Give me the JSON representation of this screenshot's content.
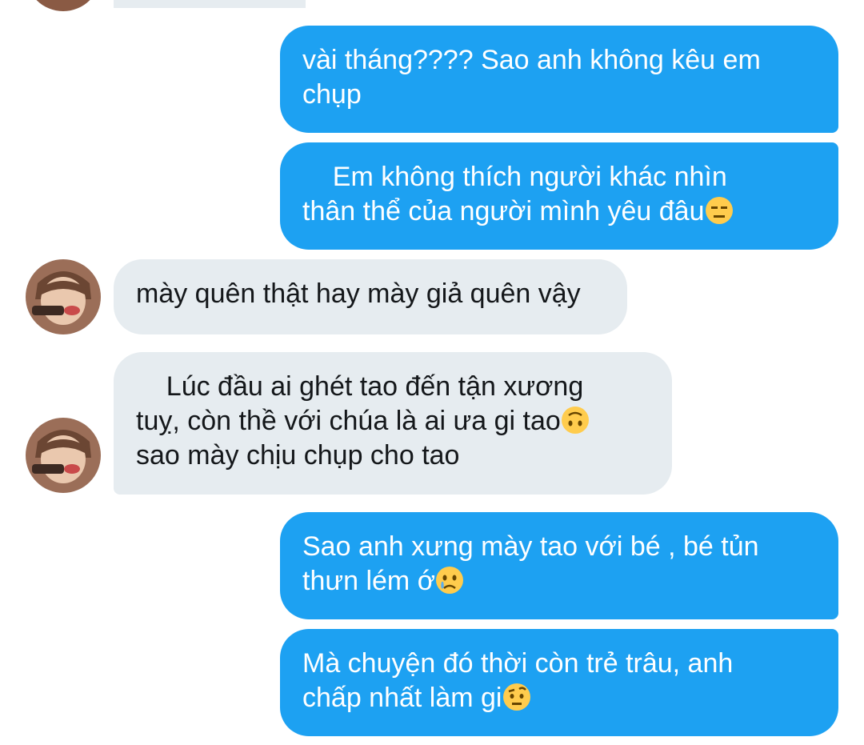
{
  "messages": [
    {
      "side": "in",
      "text": ""
    },
    {
      "side": "out",
      "lines": [
        "vài tháng???? Sao anh không kêu em",
        "chụp"
      ]
    },
    {
      "side": "out",
      "lines": [
        "    Em không thích người khác nhìn",
        "thân thể của người mình yêu đâu"
      ],
      "emoji": "expressionless-face-icon"
    },
    {
      "side": "in",
      "lines": [
        "mày quên thật hay mày giả quên vậy"
      ]
    },
    {
      "side": "in",
      "lines": [
        "    Lúc đầu ai ghét tao đến tận xương",
        "tuỵ, còn thề với chúa là ai ưa gi tao",
        "sao mày chịu chụp cho tao"
      ],
      "emoji": "upside-down-face-icon"
    },
    {
      "side": "out",
      "lines": [
        "Sao anh xưng mày tao với bé , bé tủn",
        "thưn lém ớ"
      ],
      "emoji": "crying-face-icon"
    },
    {
      "side": "out",
      "lines": [
        "Mà chuyện đó thời còn trẻ trâu, anh",
        "chấp nhất làm gi"
      ],
      "emoji": "raised-eyebrow-face-icon"
    }
  ],
  "colors": {
    "outgoing_bubble": "#1da1f2",
    "incoming_bubble": "#e6ecf0",
    "outgoing_text": "#ffffff",
    "incoming_text": "#14171a"
  }
}
